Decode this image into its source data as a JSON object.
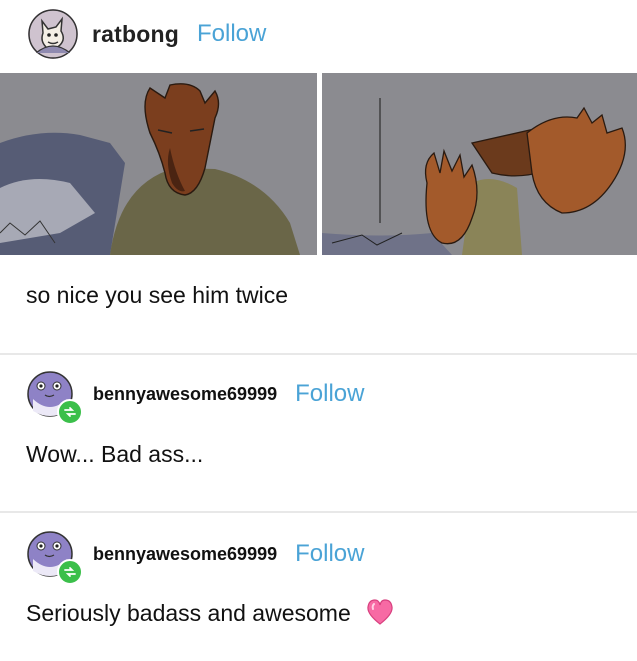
{
  "post": {
    "username": "ratbong",
    "follow_label": "Follow",
    "caption": "so nice you see him twice"
  },
  "reblogs": [
    {
      "username": "bennyawesome69999",
      "follow_label": "Follow",
      "text": "Wow... Bad ass..."
    },
    {
      "username": "bennyawesome69999",
      "follow_label": "Follow",
      "text": "Seriously badass and awesome"
    }
  ],
  "colors": {
    "follow": "#4aa3d6",
    "reblog_badge": "#3bbf4a",
    "divider": "#e8e8e8"
  },
  "icons": [
    "avatar",
    "reblog-icon",
    "heart-emoji"
  ]
}
